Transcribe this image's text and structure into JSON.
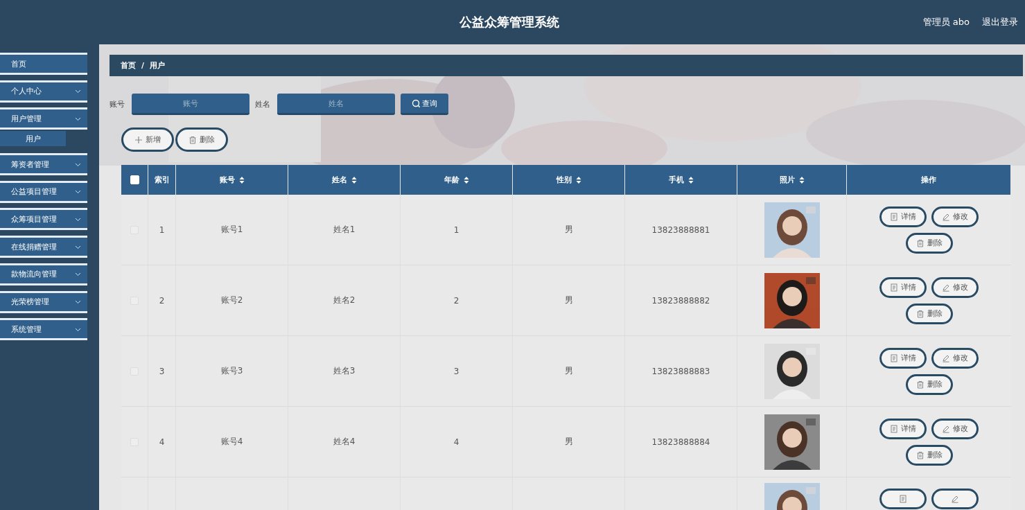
{
  "header": {
    "title": "公益众筹管理系统",
    "user": "管理员 abo",
    "logout": "退出登录"
  },
  "sidebar": {
    "items": [
      {
        "label": "首页",
        "kind": "link"
      },
      {
        "label": "个人中心",
        "kind": "group"
      },
      {
        "label": "用户管理",
        "kind": "group",
        "children": [
          {
            "label": "用户"
          }
        ]
      },
      {
        "label": "筹资者管理",
        "kind": "group"
      },
      {
        "label": "公益项目管理",
        "kind": "group"
      },
      {
        "label": "众筹项目管理",
        "kind": "group"
      },
      {
        "label": "在线捐赠管理",
        "kind": "group"
      },
      {
        "label": "款物流向管理",
        "kind": "group"
      },
      {
        "label": "光荣榜管理",
        "kind": "group"
      },
      {
        "label": "系统管理",
        "kind": "group"
      }
    ]
  },
  "breadcrumb": [
    "首页",
    "用户"
  ],
  "breadcrumb_separator": "/",
  "search": {
    "fields": [
      {
        "label": "账号",
        "placeholder": "账号"
      },
      {
        "label": "姓名",
        "placeholder": "姓名"
      }
    ],
    "button": "查询"
  },
  "actions": [
    {
      "label": "新增",
      "kind": "add"
    },
    {
      "label": "删除",
      "kind": "delete"
    }
  ],
  "table": {
    "header_checked": false,
    "columns": [
      {
        "label": "索引",
        "kind": "plain"
      },
      {
        "label": "账号",
        "kind": "sortable"
      },
      {
        "label": "姓名",
        "kind": "sortable"
      },
      {
        "label": "年龄",
        "kind": "sortable"
      },
      {
        "label": "性别",
        "kind": "sortable"
      },
      {
        "label": "手机",
        "kind": "sortable"
      },
      {
        "label": "照片",
        "kind": "sortable"
      },
      {
        "label": "操作",
        "kind": "plain"
      }
    ],
    "rows": [
      {
        "checked": false,
        "index": "1",
        "account": "账号1",
        "name": "姓名1",
        "age": "1",
        "gender": "男",
        "phone": "13823888881",
        "photo": {
          "kind": "picture"
        },
        "buttons": [
          {
            "label": "详情",
            "kind": "detail"
          },
          {
            "label": "修改",
            "kind": "edit"
          },
          {
            "label": "删除",
            "kind": "delete"
          }
        ]
      },
      {
        "checked": false,
        "index": "2",
        "account": "账号2",
        "name": "姓名2",
        "age": "2",
        "gender": "男",
        "phone": "13823888882",
        "photo": {
          "kind": "picture"
        },
        "buttons": [
          {
            "label": "详情",
            "kind": "detail"
          },
          {
            "label": "修改",
            "kind": "edit"
          },
          {
            "label": "删除",
            "kind": "delete"
          }
        ]
      },
      {
        "checked": false,
        "index": "3",
        "account": "账号3",
        "name": "姓名3",
        "age": "3",
        "gender": "男",
        "phone": "13823888883",
        "photo": {
          "kind": "picture"
        },
        "buttons": [
          {
            "label": "详情",
            "kind": "detail"
          },
          {
            "label": "修改",
            "kind": "edit"
          },
          {
            "label": "删除",
            "kind": "delete"
          }
        ]
      },
      {
        "checked": false,
        "index": "4",
        "account": "账号4",
        "name": "姓名4",
        "age": "4",
        "gender": "男",
        "phone": "13823888884",
        "photo": {
          "kind": "picture"
        },
        "buttons": [
          {
            "label": "详情",
            "kind": "detail"
          },
          {
            "label": "修改",
            "kind": "edit"
          },
          {
            "label": "删除",
            "kind": "delete"
          }
        ]
      },
      {
        "photo": {
          "kind": "picture"
        },
        "buttons": [
          {
            "kind": "detail"
          },
          {
            "kind": "edit"
          }
        ]
      }
    ]
  }
}
